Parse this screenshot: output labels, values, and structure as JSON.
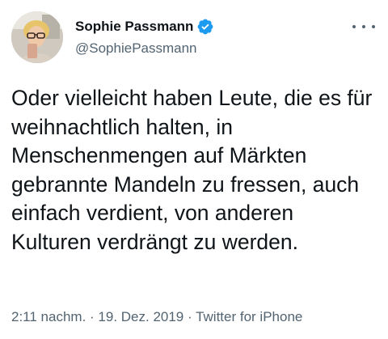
{
  "author": {
    "display_name": "Sophie Passmann",
    "handle": "@SophiePassmann",
    "verified": true
  },
  "tweet": {
    "text": "Oder vielleicht haben Leute, die es für weihnachtlich halten, in Menschenmengen auf Märkten gebrannte Mandeln zu fressen, auch einfach verdient, von anderen Kulturen verdrängt zu werden.",
    "time": "2:11 nachm.",
    "separator1": " · ",
    "date": "19. Dez. 2019",
    "separator2": " · ",
    "source": "Twitter for iPhone"
  },
  "colors": {
    "text_primary": "#0f1419",
    "text_secondary": "#536471",
    "verified_blue": "#1d9bf0"
  },
  "icons": {
    "verified": "verified-badge-icon",
    "more": "more-options-icon"
  }
}
